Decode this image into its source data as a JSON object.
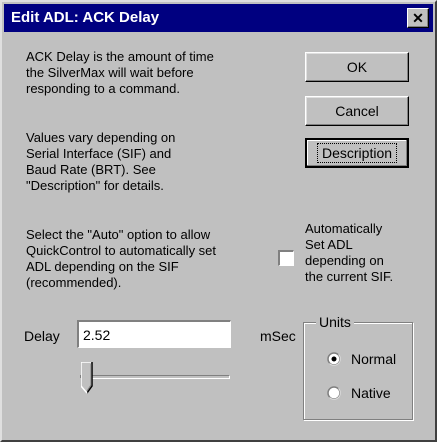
{
  "dialog": {
    "title": "Edit ADL:  ACK Delay",
    "close_glyph": "✕"
  },
  "description": {
    "para1": [
      "ACK Delay is the amount of time",
      "the SilverMax will wait before",
      "responding to a command."
    ],
    "para2": [
      "Values vary depending on",
      "Serial Interface (SIF) and",
      "Baud Rate (BRT).  See",
      "\"Description\" for details."
    ],
    "para3": [
      "Select the \"Auto\" option to allow",
      "QuickControl to automatically set",
      "ADL depending on the SIF",
      "(recommended)."
    ]
  },
  "buttons": {
    "ok": "OK",
    "cancel": "Cancel",
    "description": "Description"
  },
  "auto_option": {
    "checked": false,
    "lines": [
      "Automatically",
      "Set ADL",
      "depending on",
      "the current SIF."
    ]
  },
  "delay": {
    "label": "Delay",
    "value": "2.52",
    "unit": "mSec",
    "slider_level": 0.0
  },
  "units": {
    "label": "Units",
    "options": [
      "Normal",
      "Native"
    ],
    "selected": "Normal"
  },
  "icons": {
    "close": "close-icon",
    "slider_thumb": "slider-thumb-icon",
    "radio": "radio-icon"
  }
}
